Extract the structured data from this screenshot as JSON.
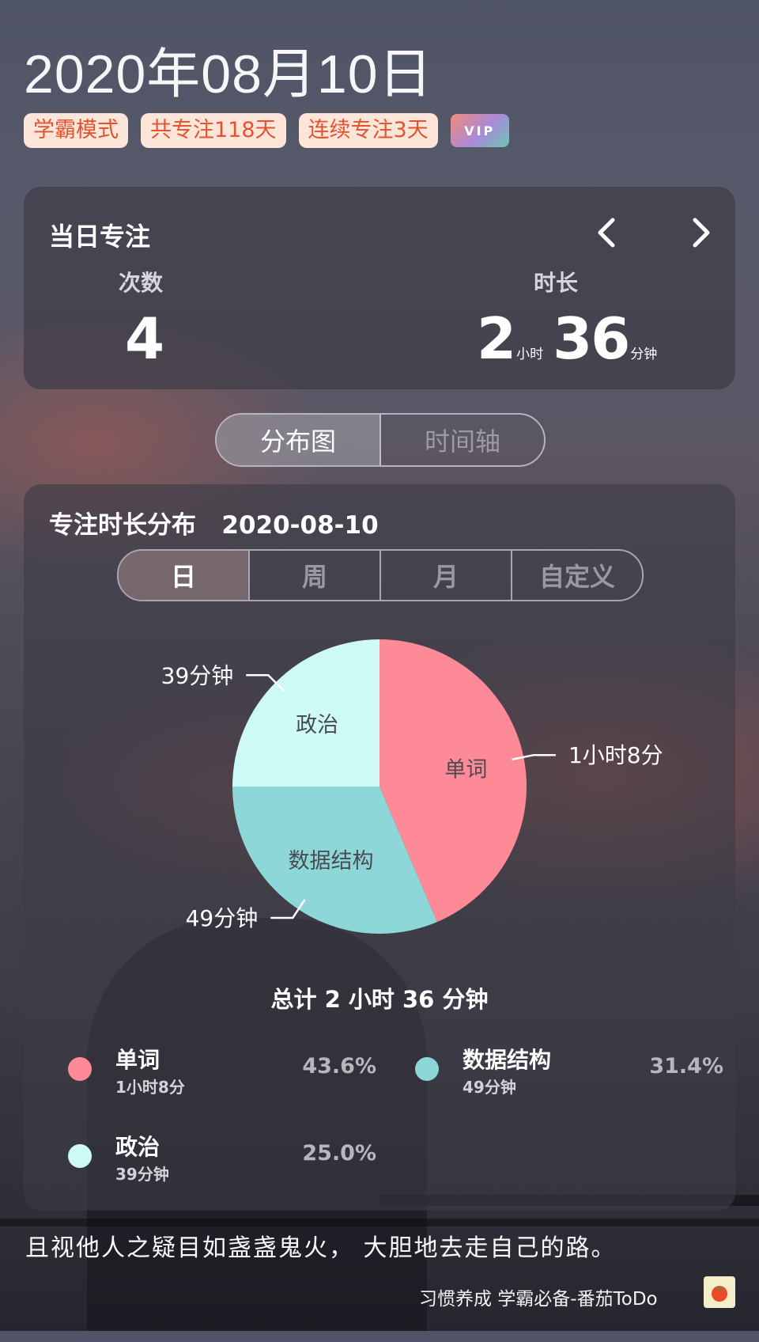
{
  "header": {
    "date": "2020年08月10日",
    "badges": [
      "学霸模式",
      "共专注118天",
      "连续专注3天"
    ],
    "vip_label": "VIP"
  },
  "daily_focus": {
    "title": "当日专注",
    "count_label": "次数",
    "count_value": "4",
    "duration_label": "时长",
    "hours": "2",
    "hours_unit": "小时",
    "minutes": "36",
    "minutes_unit": "分钟"
  },
  "view_toggle": {
    "distribution": "分布图",
    "timeline": "时间轴",
    "active": "分布图"
  },
  "distribution": {
    "title": "专注时长分布",
    "date": "2020-08-10",
    "period_tabs": [
      "日",
      "周",
      "月",
      "自定义"
    ],
    "active_period": "日",
    "total_label": "总计 2 小时 36 分钟"
  },
  "chart_data": {
    "type": "pie",
    "slices": [
      {
        "name": "单词",
        "minutes": 68,
        "duration_label": "1小时8分",
        "percent": 43.6,
        "percent_label": "43.6%",
        "color": "#fd8a96"
      },
      {
        "name": "数据结构",
        "minutes": 49,
        "duration_label": "49分钟",
        "percent": 31.4,
        "percent_label": "31.4%",
        "color": "#8ed7d9"
      },
      {
        "name": "政治",
        "minutes": 39,
        "duration_label": "39分钟",
        "percent": 25.0,
        "percent_label": "25.0%",
        "color": "#cdfaf7"
      }
    ]
  },
  "footer": {
    "quote": "且视他人之疑目如盏盏鬼火， 大胆地去走自己的路。",
    "app_slogan": "习惯养成 学霸必备-番茄ToDo"
  },
  "icons": {
    "prev": "chevron-left-icon",
    "next": "chevron-right-icon",
    "app": "tomato-icon"
  }
}
